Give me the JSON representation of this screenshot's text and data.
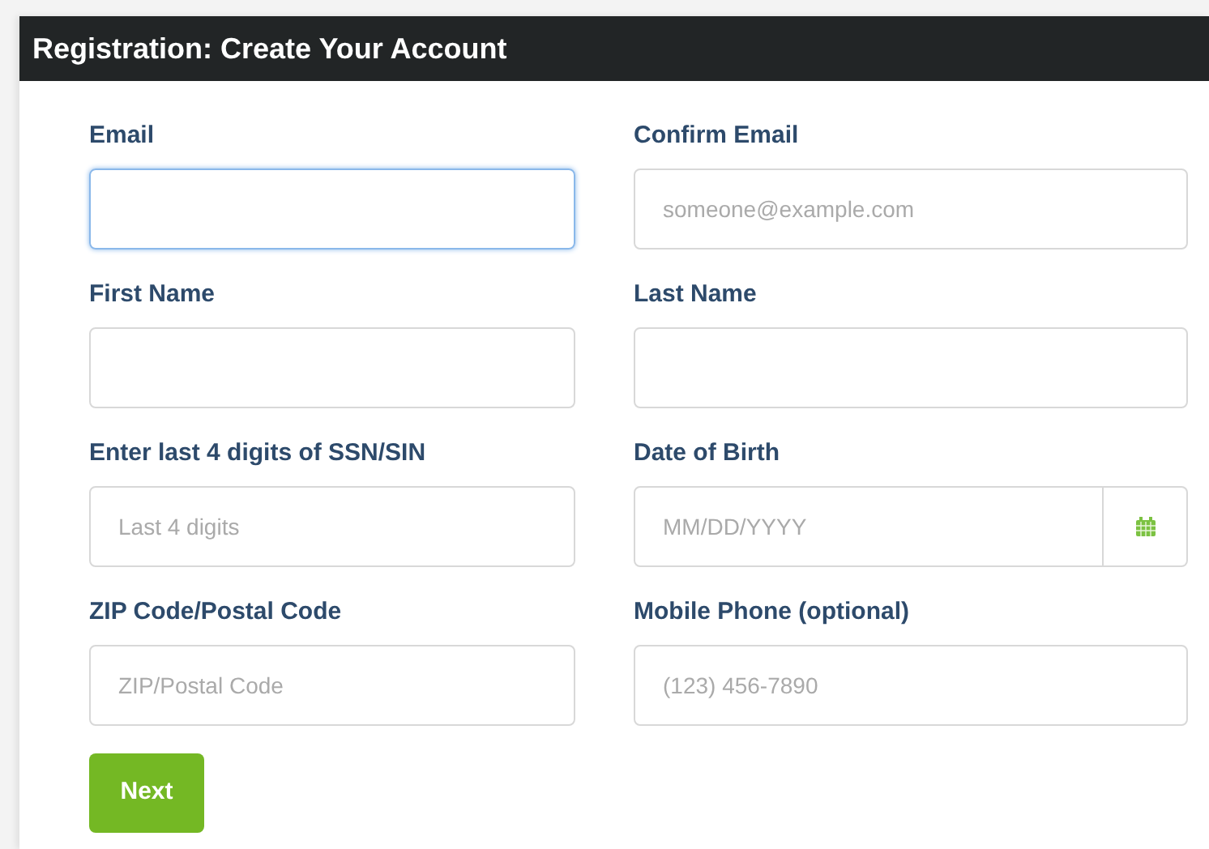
{
  "header": {
    "title": "Registration: Create Your Account"
  },
  "fields": [
    {
      "label": "Email",
      "kind": "text",
      "focused": true
    },
    {
      "label": "Confirm Email",
      "kind": "text",
      "placeholder": "someone@example.com",
      "focused": false
    },
    {
      "label": "First Name",
      "kind": "text",
      "focused": false
    },
    {
      "label": "Last Name",
      "kind": "text",
      "focused": false
    },
    {
      "label": "Enter last 4 digits of SSN/SIN",
      "kind": "text",
      "placeholder": "Last 4 digits",
      "focused": false
    },
    {
      "label": "Date of Birth",
      "kind": "date",
      "placeholder": "MM/DD/YYYY",
      "focused": false
    },
    {
      "label": "ZIP Code/Postal Code",
      "kind": "text",
      "placeholder": "ZIP/Postal Code",
      "focused": false
    },
    {
      "label": "Mobile Phone (optional)",
      "kind": "text",
      "placeholder": "(123) 456-7890",
      "focused": false
    }
  ],
  "submit": {
    "label": "Next"
  }
}
